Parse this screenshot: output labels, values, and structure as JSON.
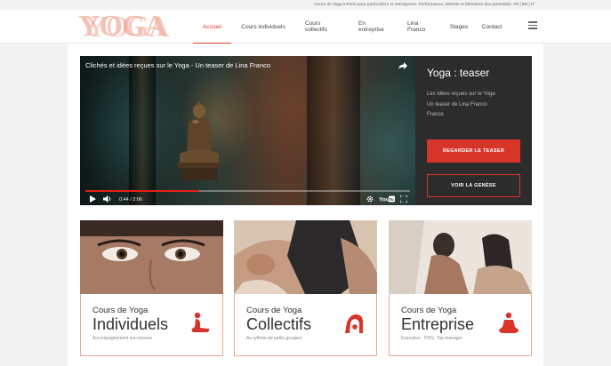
{
  "topbar": {
    "text": "Cours de Yoga à Paris pour particuliers et entreprises. Performance, détente et libération des potentiels. FR | EN | IT"
  },
  "logo": {
    "text": "YOGA"
  },
  "nav": {
    "items": [
      {
        "label": "Accueil",
        "active": true
      },
      {
        "label": "Cours individuels",
        "active": false
      },
      {
        "label": "Cours collectifs",
        "active": false
      },
      {
        "label": "En entreprise",
        "active": false
      },
      {
        "label": "Lina Franco",
        "active": false
      },
      {
        "label": "Stages",
        "active": false
      },
      {
        "label": "Contact",
        "active": false
      }
    ]
  },
  "video": {
    "title": "Clichés et idées reçues sur le Yoga - Un teaser de Lina Franco",
    "time": "0:44 / 2:06",
    "progress": 0.35
  },
  "side": {
    "heading": "Yoga : teaser",
    "line1": "Les idées reçues sur le Yoga",
    "line2": "Un teaser de Lina Franco",
    "line3": "France",
    "button1": "REGARDER LE TEASER",
    "button2": "VOIR LA GENÈSE"
  },
  "cards": [
    {
      "small": "Cours de Yoga",
      "big": "Individuels",
      "sub": "Accompagnement sur-mesure"
    },
    {
      "small": "Cours de Yoga",
      "big": "Collectifs",
      "sub": "Au rythme de petits groupes"
    },
    {
      "small": "Cours de Yoga",
      "big": "Entreprise",
      "sub": "Executive - PDG, Top manager"
    }
  ],
  "colors": {
    "accent": "#d8352a",
    "logo": "#f6c1b4",
    "side_bg": "#2c2c2c"
  }
}
